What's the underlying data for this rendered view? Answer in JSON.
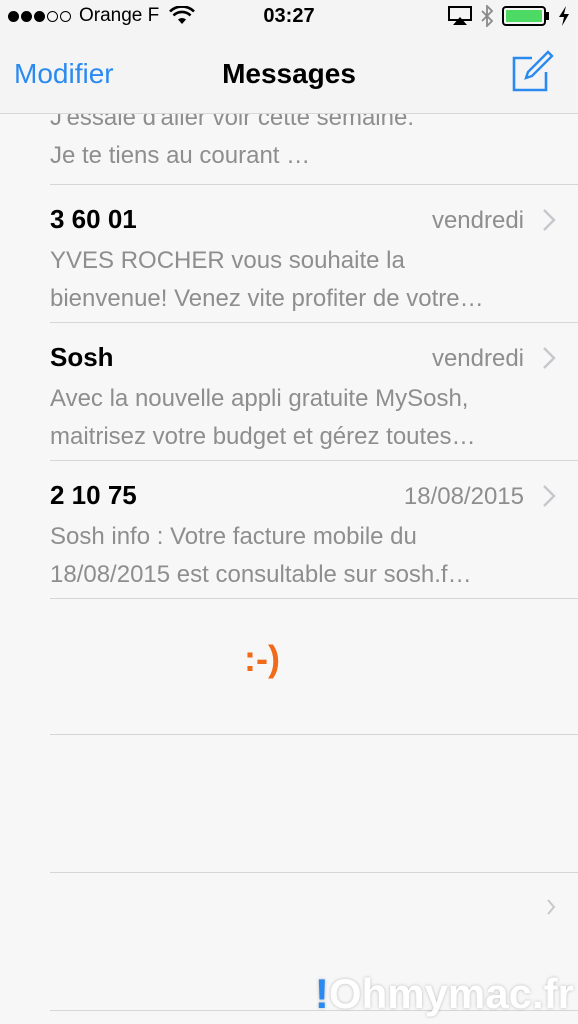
{
  "status_bar": {
    "carrier": "Orange F",
    "time": "03:27",
    "signal_bars_filled": 3,
    "signal_bars_total": 5
  },
  "nav": {
    "left_button": "Modifier",
    "title": "Messages",
    "compose_icon": "compose-icon"
  },
  "partial_message": {
    "line1": "J'essaie d'aller voir cette semaine.",
    "line2": "Je te tiens au courant …"
  },
  "messages": [
    {
      "sender": "3 60 01",
      "date": "vendredi",
      "preview_line1": "YVES ROCHER vous souhaite la",
      "preview_line2": "bienvenue! Venez vite profiter de votre…"
    },
    {
      "sender": "Sosh",
      "date": "vendredi",
      "preview_line1": "Avec la nouvelle appli gratuite MySosh,",
      "preview_line2": "maitrisez votre budget et gérez toutes…"
    },
    {
      "sender": "2 10 75",
      "date": "18/08/2015",
      "preview_line1": "Sosh info : Votre facture mobile du",
      "preview_line2": "18/08/2015 est consultable sur sosh.f…"
    }
  ],
  "overlay_text": ":-)",
  "watermark": {
    "bang": "!",
    "text": "Ohmymac.fr"
  },
  "colors": {
    "accent": "#2a8af0",
    "smiley": "#f06a1a",
    "battery": "#4cd964"
  }
}
